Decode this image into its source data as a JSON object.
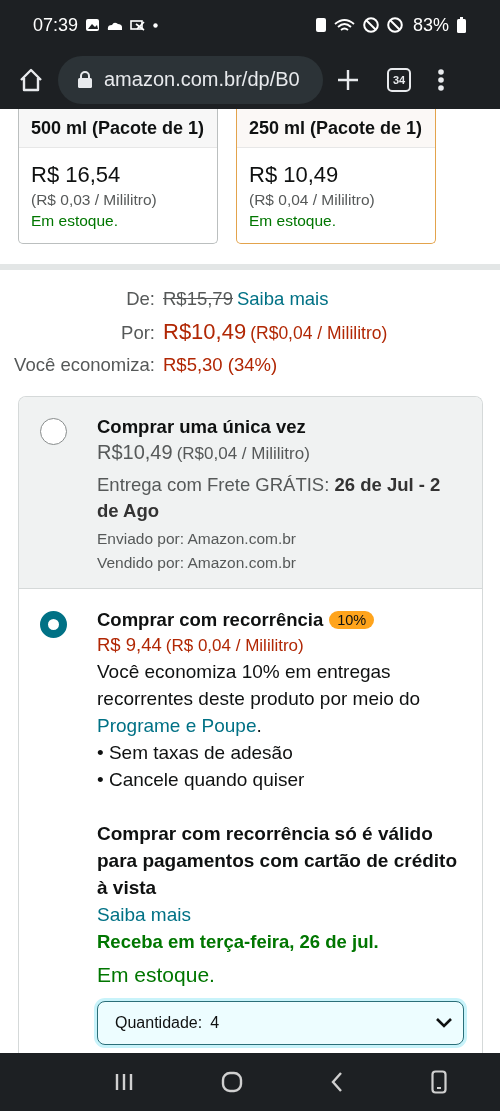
{
  "status_bar": {
    "time": "07:39",
    "battery": "83%"
  },
  "browser": {
    "url": "amazon.com.br/dp/B0",
    "tab_count": "34"
  },
  "variants": [
    {
      "title": "500 ml (Pacote de 1)",
      "price": "R$ 16,54",
      "unit_price": "(R$ 0,03 / Mililitro)",
      "stock": "Em estoque.",
      "selected": false
    },
    {
      "title": "250 ml (Pacote de 1)",
      "price": "R$ 10,49",
      "unit_price": "(R$ 0,04 / Mililitro)",
      "stock": "Em estoque.",
      "selected": true
    }
  ],
  "pricing": {
    "list_label": "De:",
    "list_price": "R$15,79",
    "list_link": "Saiba mais",
    "price_label": "Por:",
    "price": "R$10,49",
    "unit_price": "(R$0,04 / Mililitro)",
    "savings_label": "Você economiza:",
    "savings": "R$5,30 (34%)"
  },
  "purchase_options": [
    {
      "kind": "one_time",
      "selected": false,
      "title": "Comprar uma única vez",
      "price": "R$10,49",
      "unit_price": "(R$0,04 / Mililitro)",
      "delivery": "Entrega com Frete GRÁTIS: **26 de Jul - 2 de Ago**",
      "shipped_by": "Enviado por: Amazon.com.br",
      "sold_by": "Vendido por: Amazon.com.br"
    },
    {
      "kind": "subscription",
      "selected": true,
      "title": "Comprar com recorrência",
      "badge": "10%",
      "price": "R$ 9,44",
      "unit_price": "(R$ 0,04 / Mililitro)",
      "description": "Você economiza 10% em entregas recorrentes deste produto por meio do ",
      "description_link": "Programe e Poupe",
      "description_end": ".",
      "bullets": [
        "• Sem taxas de adesão",
        "• Cancele quando quiser"
      ],
      "note": "Comprar com recorrência só é válido para pagamentos com cartão de crédito à vista",
      "note_link": "Saiba mais",
      "delivery": "Receba em terça-feira, 26 de jul.",
      "stock": "Em estoque.",
      "quantity": {
        "label": "Quantidade:",
        "value": "4"
      }
    }
  ]
}
